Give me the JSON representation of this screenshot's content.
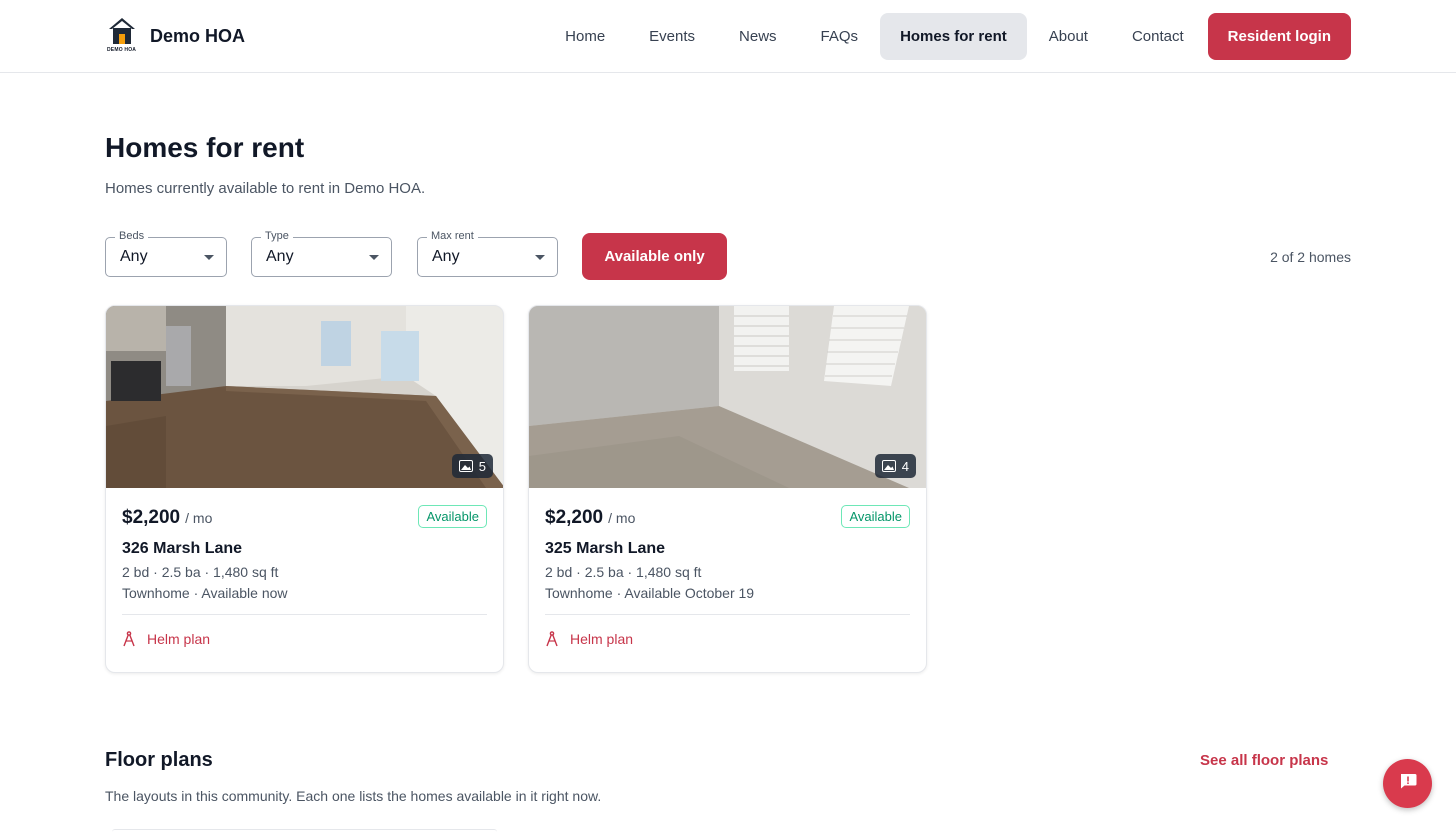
{
  "brand": {
    "name": "Demo HOA",
    "logo_text": "DEMO HOA",
    "accent_color": "#c7354a"
  },
  "nav": {
    "items": [
      {
        "label": "Home"
      },
      {
        "label": "Events"
      },
      {
        "label": "News"
      },
      {
        "label": "FAQs"
      },
      {
        "label": "Homes for rent",
        "active": true
      },
      {
        "label": "About"
      },
      {
        "label": "Contact"
      }
    ],
    "login_label": "Resident login"
  },
  "page": {
    "title": "Homes for rent",
    "subtitle": "Homes currently available to rent in Demo HOA."
  },
  "filters": {
    "beds": {
      "label": "Beds",
      "value": "Any"
    },
    "type": {
      "label": "Type",
      "value": "Any"
    },
    "max_rent": {
      "label": "Max rent",
      "value": "Any"
    },
    "available_only_label": "Available only",
    "result_count": "2 of 2 homes"
  },
  "listings": [
    {
      "photo_count": "5",
      "price": "$2,200",
      "period": "/ mo",
      "status": "Available",
      "address": "326 Marsh Lane",
      "specs": "2 bd · 2.5 ba · 1,480 sq ft",
      "availability": "Townhome · Available now",
      "plan": "Helm plan"
    },
    {
      "photo_count": "4",
      "price": "$2,200",
      "period": "/ mo",
      "status": "Available",
      "address": "325 Marsh Lane",
      "specs": "2 bd · 2.5 ba · 1,480 sq ft",
      "availability": "Townhome · Available October 19",
      "plan": "Helm plan"
    }
  ],
  "floor_plans": {
    "title": "Floor plans",
    "see_all_label": "See all floor plans",
    "subtitle": "The layouts in this community. Each one lists the homes available in it right now."
  },
  "icons": {
    "logo": "house-icon",
    "filter_caret": "chevron-down-icon",
    "photos": "image-gallery-icon",
    "plan": "drafting-compass-icon",
    "feedback": "feedback-icon"
  }
}
